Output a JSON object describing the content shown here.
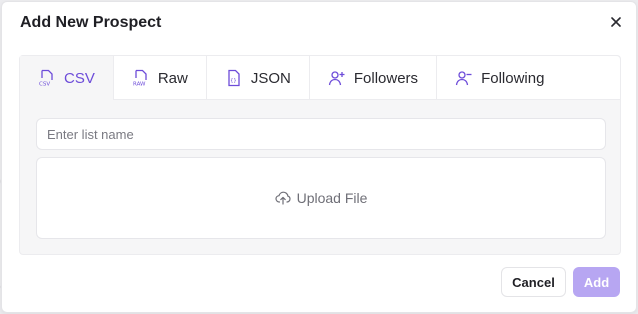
{
  "dialog": {
    "title": "Add New Prospect",
    "close_icon": "close-icon"
  },
  "tabs": [
    {
      "label": "CSV",
      "icon": "csv-file-icon",
      "active": true
    },
    {
      "label": "Raw",
      "icon": "raw-file-icon",
      "active": false
    },
    {
      "label": "JSON",
      "icon": "json-file-icon",
      "active": false
    },
    {
      "label": "Followers",
      "icon": "user-plus-icon",
      "active": false
    },
    {
      "label": "Following",
      "icon": "user-minus-icon",
      "active": false
    }
  ],
  "list_name": {
    "placeholder": "Enter list name",
    "value": ""
  },
  "upload": {
    "label": "Upload File",
    "icon": "cloud-upload-icon"
  },
  "footer": {
    "cancel_label": "Cancel",
    "add_label": "Add"
  },
  "colors": {
    "accent": "#6d4cd9",
    "add_button_disabled": "#b7a6f2"
  }
}
